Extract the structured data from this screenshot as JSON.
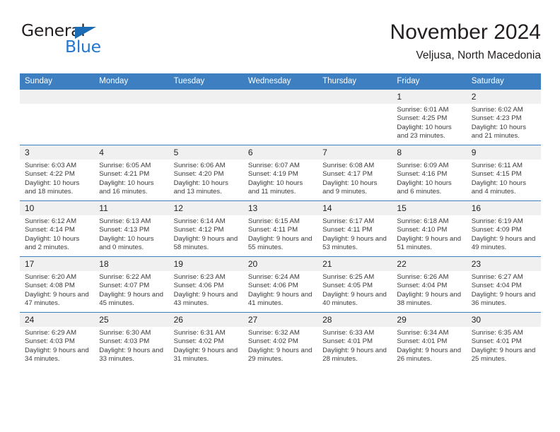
{
  "logo": {
    "word_primary": "General",
    "word_secondary": "Blue",
    "triangle_color": "#1b6cb5",
    "secondary_color": "#2277cc"
  },
  "header": {
    "title": "November 2024",
    "subtitle": "Veljusa, North Macedonia"
  },
  "theme": {
    "header_blue": "#3d7fc1",
    "daynum_bg": "#f0f0f0",
    "text": "#231f20"
  },
  "calendar": {
    "weekday_headers": [
      "Sunday",
      "Monday",
      "Tuesday",
      "Wednesday",
      "Thursday",
      "Friday",
      "Saturday"
    ],
    "labels": {
      "sunrise": "Sunrise:",
      "sunset": "Sunset:",
      "daylight": "Daylight:"
    },
    "weeks": [
      [
        {
          "day": "",
          "empty": true
        },
        {
          "day": "",
          "empty": true
        },
        {
          "day": "",
          "empty": true
        },
        {
          "day": "",
          "empty": true
        },
        {
          "day": "",
          "empty": true
        },
        {
          "day": "1",
          "sunrise": "Sunrise: 6:01 AM",
          "sunset": "Sunset: 4:25 PM",
          "daylight": "Daylight: 10 hours and 23 minutes."
        },
        {
          "day": "2",
          "sunrise": "Sunrise: 6:02 AM",
          "sunset": "Sunset: 4:23 PM",
          "daylight": "Daylight: 10 hours and 21 minutes."
        }
      ],
      [
        {
          "day": "3",
          "sunrise": "Sunrise: 6:03 AM",
          "sunset": "Sunset: 4:22 PM",
          "daylight": "Daylight: 10 hours and 18 minutes."
        },
        {
          "day": "4",
          "sunrise": "Sunrise: 6:05 AM",
          "sunset": "Sunset: 4:21 PM",
          "daylight": "Daylight: 10 hours and 16 minutes."
        },
        {
          "day": "5",
          "sunrise": "Sunrise: 6:06 AM",
          "sunset": "Sunset: 4:20 PM",
          "daylight": "Daylight: 10 hours and 13 minutes."
        },
        {
          "day": "6",
          "sunrise": "Sunrise: 6:07 AM",
          "sunset": "Sunset: 4:19 PM",
          "daylight": "Daylight: 10 hours and 11 minutes."
        },
        {
          "day": "7",
          "sunrise": "Sunrise: 6:08 AM",
          "sunset": "Sunset: 4:17 PM",
          "daylight": "Daylight: 10 hours and 9 minutes."
        },
        {
          "day": "8",
          "sunrise": "Sunrise: 6:09 AM",
          "sunset": "Sunset: 4:16 PM",
          "daylight": "Daylight: 10 hours and 6 minutes."
        },
        {
          "day": "9",
          "sunrise": "Sunrise: 6:11 AM",
          "sunset": "Sunset: 4:15 PM",
          "daylight": "Daylight: 10 hours and 4 minutes."
        }
      ],
      [
        {
          "day": "10",
          "sunrise": "Sunrise: 6:12 AM",
          "sunset": "Sunset: 4:14 PM",
          "daylight": "Daylight: 10 hours and 2 minutes."
        },
        {
          "day": "11",
          "sunrise": "Sunrise: 6:13 AM",
          "sunset": "Sunset: 4:13 PM",
          "daylight": "Daylight: 10 hours and 0 minutes."
        },
        {
          "day": "12",
          "sunrise": "Sunrise: 6:14 AM",
          "sunset": "Sunset: 4:12 PM",
          "daylight": "Daylight: 9 hours and 58 minutes."
        },
        {
          "day": "13",
          "sunrise": "Sunrise: 6:15 AM",
          "sunset": "Sunset: 4:11 PM",
          "daylight": "Daylight: 9 hours and 55 minutes."
        },
        {
          "day": "14",
          "sunrise": "Sunrise: 6:17 AM",
          "sunset": "Sunset: 4:11 PM",
          "daylight": "Daylight: 9 hours and 53 minutes."
        },
        {
          "day": "15",
          "sunrise": "Sunrise: 6:18 AM",
          "sunset": "Sunset: 4:10 PM",
          "daylight": "Daylight: 9 hours and 51 minutes."
        },
        {
          "day": "16",
          "sunrise": "Sunrise: 6:19 AM",
          "sunset": "Sunset: 4:09 PM",
          "daylight": "Daylight: 9 hours and 49 minutes."
        }
      ],
      [
        {
          "day": "17",
          "sunrise": "Sunrise: 6:20 AM",
          "sunset": "Sunset: 4:08 PM",
          "daylight": "Daylight: 9 hours and 47 minutes."
        },
        {
          "day": "18",
          "sunrise": "Sunrise: 6:22 AM",
          "sunset": "Sunset: 4:07 PM",
          "daylight": "Daylight: 9 hours and 45 minutes."
        },
        {
          "day": "19",
          "sunrise": "Sunrise: 6:23 AM",
          "sunset": "Sunset: 4:06 PM",
          "daylight": "Daylight: 9 hours and 43 minutes."
        },
        {
          "day": "20",
          "sunrise": "Sunrise: 6:24 AM",
          "sunset": "Sunset: 4:06 PM",
          "daylight": "Daylight: 9 hours and 41 minutes."
        },
        {
          "day": "21",
          "sunrise": "Sunrise: 6:25 AM",
          "sunset": "Sunset: 4:05 PM",
          "daylight": "Daylight: 9 hours and 40 minutes."
        },
        {
          "day": "22",
          "sunrise": "Sunrise: 6:26 AM",
          "sunset": "Sunset: 4:04 PM",
          "daylight": "Daylight: 9 hours and 38 minutes."
        },
        {
          "day": "23",
          "sunrise": "Sunrise: 6:27 AM",
          "sunset": "Sunset: 4:04 PM",
          "daylight": "Daylight: 9 hours and 36 minutes."
        }
      ],
      [
        {
          "day": "24",
          "sunrise": "Sunrise: 6:29 AM",
          "sunset": "Sunset: 4:03 PM",
          "daylight": "Daylight: 9 hours and 34 minutes."
        },
        {
          "day": "25",
          "sunrise": "Sunrise: 6:30 AM",
          "sunset": "Sunset: 4:03 PM",
          "daylight": "Daylight: 9 hours and 33 minutes."
        },
        {
          "day": "26",
          "sunrise": "Sunrise: 6:31 AM",
          "sunset": "Sunset: 4:02 PM",
          "daylight": "Daylight: 9 hours and 31 minutes."
        },
        {
          "day": "27",
          "sunrise": "Sunrise: 6:32 AM",
          "sunset": "Sunset: 4:02 PM",
          "daylight": "Daylight: 9 hours and 29 minutes."
        },
        {
          "day": "28",
          "sunrise": "Sunrise: 6:33 AM",
          "sunset": "Sunset: 4:01 PM",
          "daylight": "Daylight: 9 hours and 28 minutes."
        },
        {
          "day": "29",
          "sunrise": "Sunrise: 6:34 AM",
          "sunset": "Sunset: 4:01 PM",
          "daylight": "Daylight: 9 hours and 26 minutes."
        },
        {
          "day": "30",
          "sunrise": "Sunrise: 6:35 AM",
          "sunset": "Sunset: 4:01 PM",
          "daylight": "Daylight: 9 hours and 25 minutes."
        }
      ]
    ]
  }
}
